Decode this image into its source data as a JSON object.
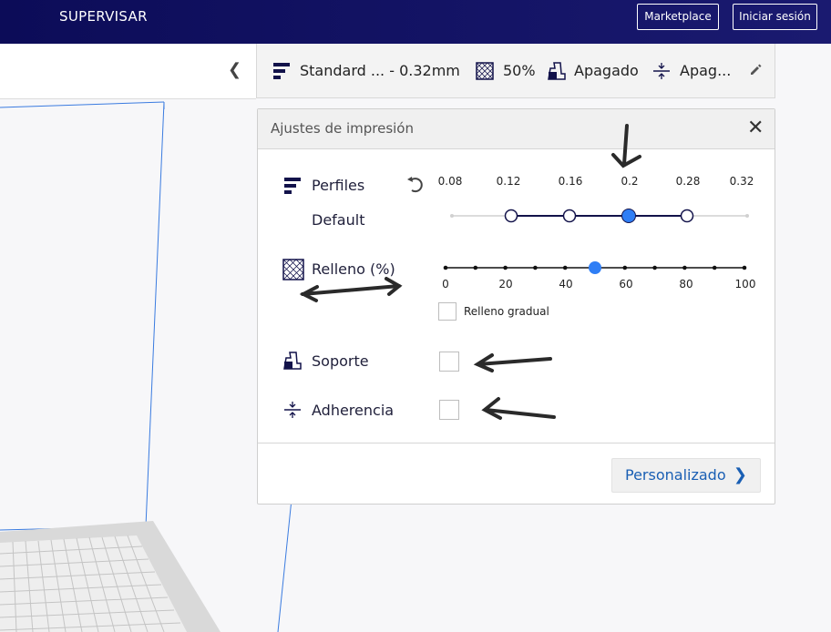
{
  "header": {
    "stage": "SUPERVISAR",
    "marketplace_label": "Marketplace",
    "login_label": "Iniciar sesión"
  },
  "settings_bar": {
    "profile": "Standard ... - 0.32mm",
    "infill": "50%",
    "support": "Apagado",
    "adhesion": "Apag..."
  },
  "print_settings": {
    "title": "Ajustes de impresión",
    "profiles": {
      "label": "Perfiles",
      "sublabel": "Default",
      "ticks": [
        "0.08",
        "0.12",
        "0.16",
        "0.2",
        "0.28",
        "0.32"
      ],
      "selected_index": 3
    },
    "infill": {
      "label": "Relleno (%)",
      "ticks": [
        "0",
        "20",
        "40",
        "60",
        "80",
        "100"
      ],
      "value": 50,
      "gradual_label": "Relleno gradual",
      "gradual_checked": false
    },
    "support": {
      "label": "Soporte",
      "checked": false
    },
    "adhesion": {
      "label": "Adherencia",
      "checked": false
    },
    "custom_button": "Personalizado"
  },
  "colors": {
    "header_bg": "#0c0c58",
    "accent": "#2f7ef5",
    "link": "#1a5fb4"
  }
}
